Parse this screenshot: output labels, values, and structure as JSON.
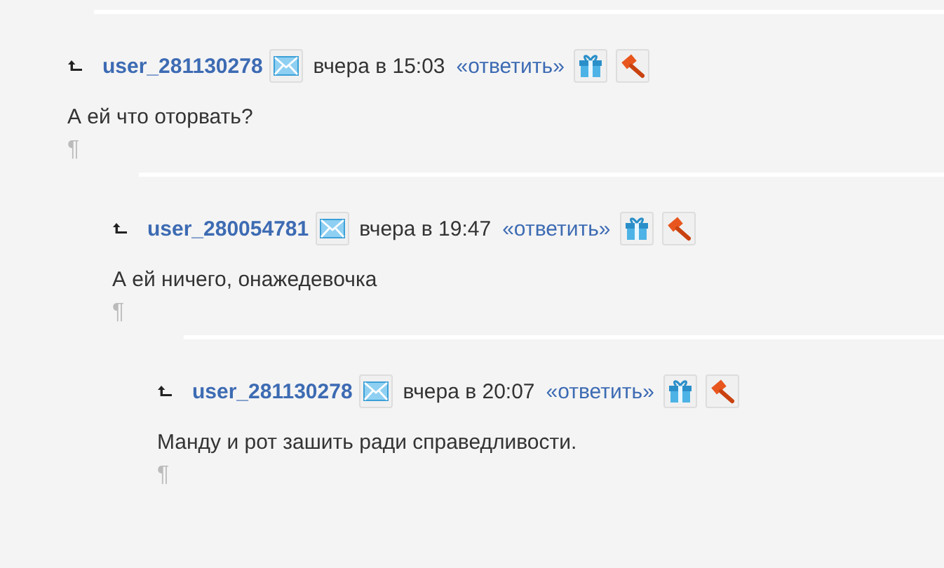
{
  "comments": [
    {
      "author": "user_281130278",
      "time": "вчера в 15:03",
      "reply": "«ответить»",
      "text": "А ей что оторвать?",
      "pilcrow": "¶",
      "children": [
        {
          "author": "user_280054781",
          "time": "вчера в 19:47",
          "reply": "«ответить»",
          "text": "А ей ничего, онажедевочка",
          "pilcrow": "¶",
          "children": [
            {
              "author": "user_281130278",
              "time": "вчера в 20:07",
              "reply": "«ответить»",
              "text": "Манду и рот зашить ради справедливости.",
              "pilcrow": "¶"
            }
          ]
        }
      ]
    }
  ]
}
